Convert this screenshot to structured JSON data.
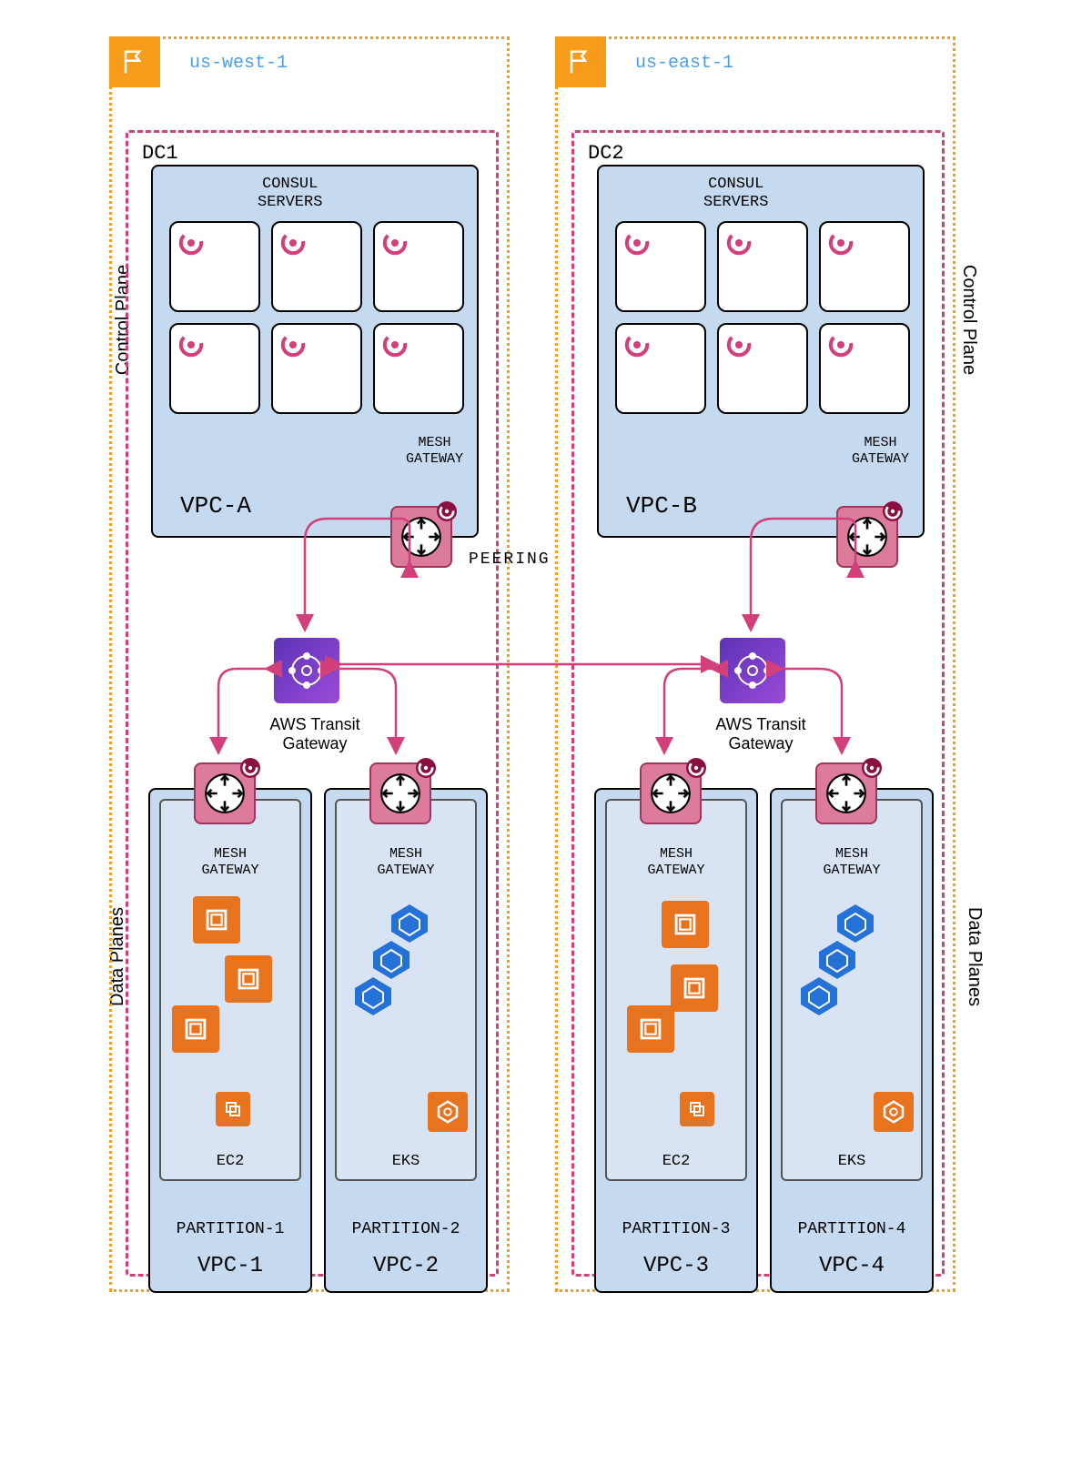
{
  "regions": {
    "west": {
      "name": "us-west-1"
    },
    "east": {
      "name": "us-east-1"
    }
  },
  "planes": {
    "control": "Control Plane",
    "data": "Data Planes"
  },
  "dc1": {
    "title": "DC1",
    "consul_header": "CONSUL\nSERVERS",
    "vpc": "VPC-A",
    "mesh_gw": "MESH\nGATEWAY"
  },
  "dc2": {
    "title": "DC2",
    "consul_header": "CONSUL\nSERVERS",
    "vpc": "VPC-B",
    "mesh_gw": "MESH\nGATEWAY"
  },
  "tgw": {
    "label": "AWS Transit Gateway",
    "peering": "PEERING"
  },
  "data_vpc1": {
    "vpc": "VPC-1",
    "partition": "PARTITION-1",
    "mesh_gw": "MESH\nGATEWAY",
    "type": "EC2"
  },
  "data_vpc2": {
    "vpc": "VPC-2",
    "partition": "PARTITION-2",
    "mesh_gw": "MESH\nGATEWAY",
    "type": "EKS"
  },
  "data_vpc3": {
    "vpc": "VPC-3",
    "partition": "PARTITION-3",
    "mesh_gw": "MESH\nGATEWAY",
    "type": "EC2"
  },
  "data_vpc4": {
    "vpc": "VPC-4",
    "partition": "PARTITION-4",
    "mesh_gw": "MESH\nGATEWAY",
    "type": "EKS"
  }
}
